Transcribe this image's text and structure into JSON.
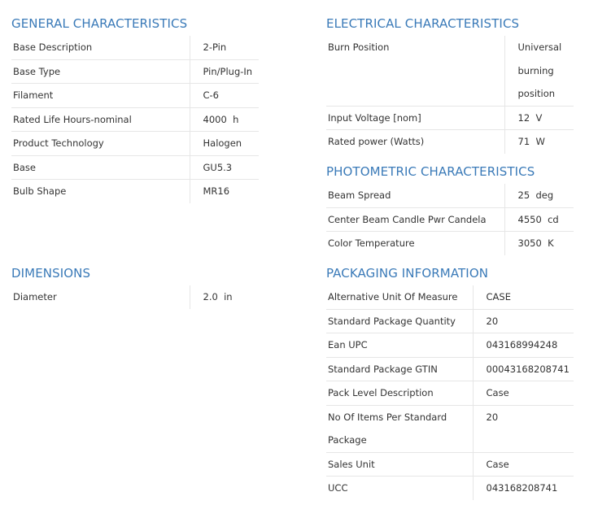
{
  "general": {
    "title": "GENERAL CHARACTERISTICS",
    "rows": [
      {
        "label": "Base Description",
        "value": "2-Pin"
      },
      {
        "label": "Base Type",
        "value": "Pin/Plug-In"
      },
      {
        "label": "Filament",
        "value": "C-6"
      },
      {
        "label": "Rated Life Hours-nominal",
        "value": "4000  h"
      },
      {
        "label": "Product Technology",
        "value": "Halogen"
      },
      {
        "label": "Base",
        "value": "GU5.3"
      },
      {
        "label": "Bulb Shape",
        "value": "MR16"
      }
    ]
  },
  "dimensions": {
    "title": "DIMENSIONS",
    "rows": [
      {
        "label": "Diameter",
        "value": "2.0  in"
      }
    ]
  },
  "electrical": {
    "title": "ELECTRICAL CHARACTERISTICS",
    "rows": [
      {
        "label": "Burn Position",
        "value": "Universal burning position"
      },
      {
        "label": "Input Voltage [nom]",
        "value": "12  V"
      },
      {
        "label": "Rated power (Watts)",
        "value": "71  W"
      }
    ]
  },
  "photometric": {
    "title": "PHOTOMETRIC CHARACTERISTICS",
    "rows": [
      {
        "label": "Beam Spread",
        "value": "25  deg"
      },
      {
        "label": "Center Beam Candle Pwr Candela",
        "value": "4550  cd"
      },
      {
        "label": "Color Temperature",
        "value": "3050  K"
      }
    ]
  },
  "packaging": {
    "title": "PACKAGING INFORMATION",
    "rows": [
      {
        "label": "Alternative Unit Of Measure",
        "value": "CASE"
      },
      {
        "label": "Standard Package Quantity",
        "value": "20"
      },
      {
        "label": "Ean UPC",
        "value": "043168994248"
      },
      {
        "label": "Standard Package GTIN",
        "value": "00043168208741"
      },
      {
        "label": "Pack Level Description",
        "value": "Case"
      },
      {
        "label": "No Of Items Per Standard Package",
        "value": "20"
      },
      {
        "label": "Sales Unit",
        "value": "Case"
      },
      {
        "label": "UCC",
        "value": "043168208741"
      }
    ]
  }
}
